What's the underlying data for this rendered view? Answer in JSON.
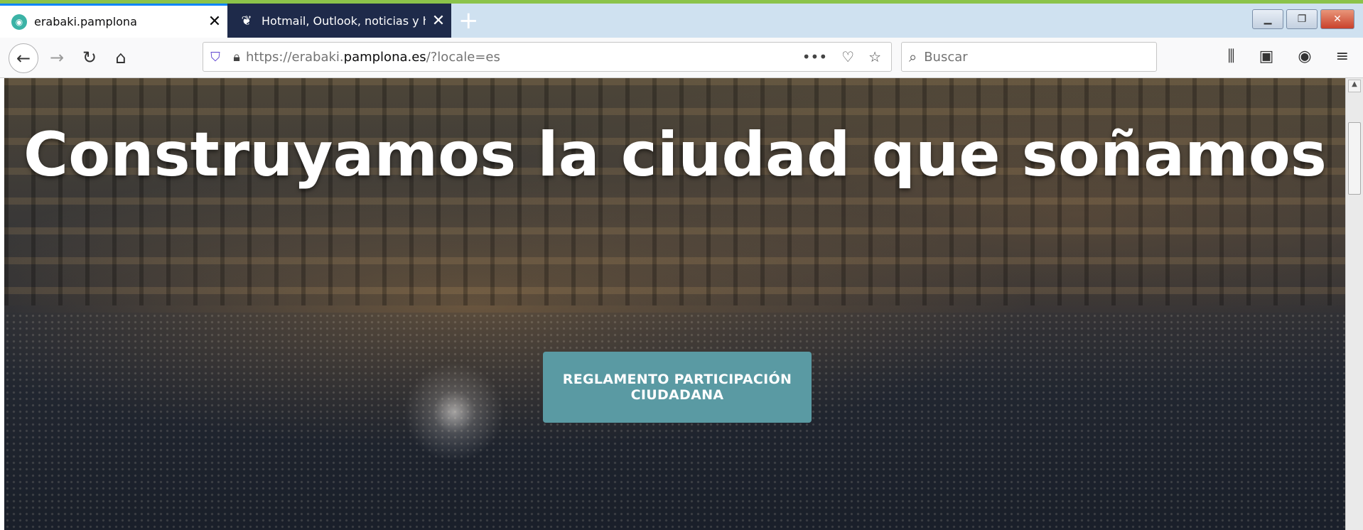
{
  "colors": {
    "accent_line": "#8bc34a",
    "cta_background": "#5a9aa3",
    "active_tab_indicator": "#0a84ff"
  },
  "tabs": [
    {
      "title": "erabaki.pamplona",
      "favicon": "erabaki-favicon-icon",
      "active": true
    },
    {
      "title": "Hotmail, Outlook, noticias y ho",
      "favicon": "msn-butterfly-icon",
      "active": false
    }
  ],
  "toolbar": {
    "url_prefix": "https://erabaki.",
    "url_domain": "pamplona.es",
    "url_suffix": "/?locale=es",
    "search_placeholder": "Buscar"
  },
  "hero": {
    "headline": "Construyamos la ciudad que soñamos",
    "cta_label": "REGLAMENTO PARTICIPACIÓN CIUDADANA"
  }
}
